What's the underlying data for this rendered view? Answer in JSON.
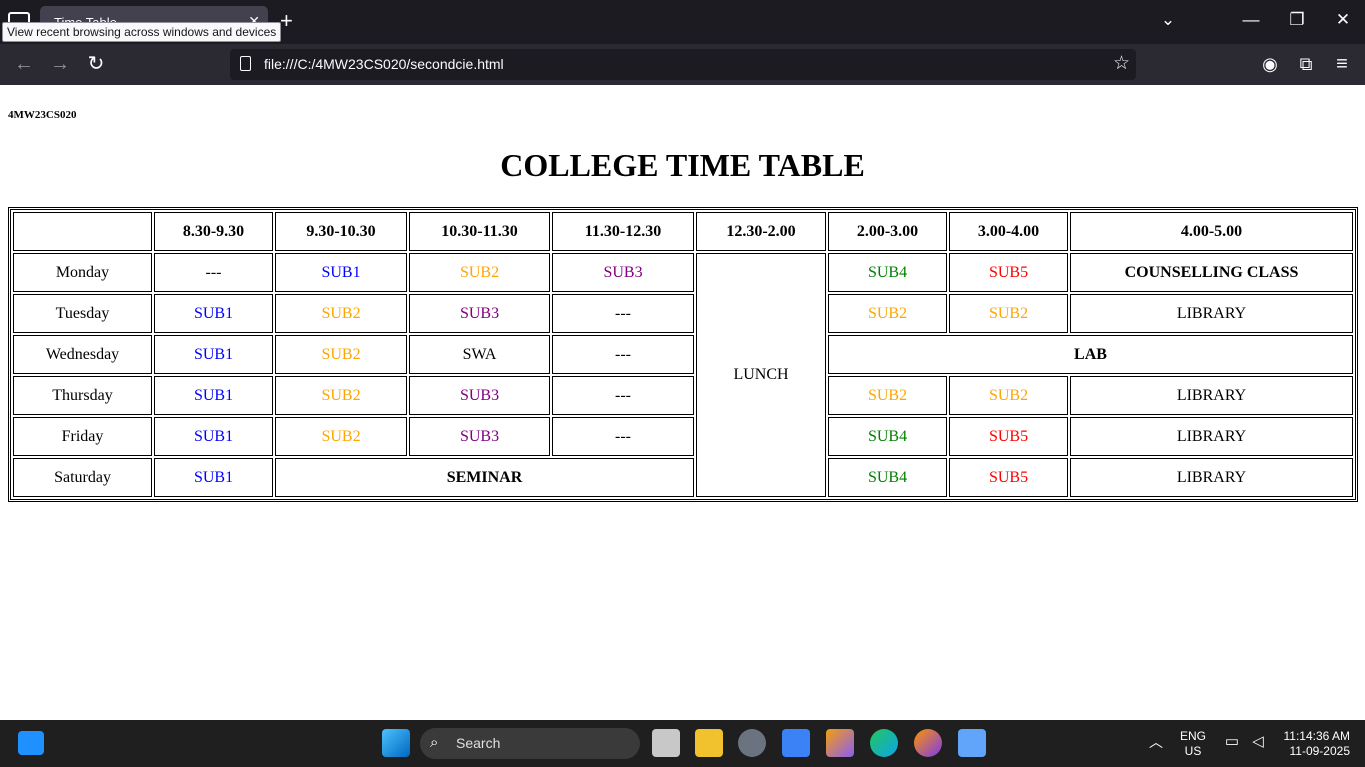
{
  "browser": {
    "tab_title": "Time Table",
    "tooltip": "View recent browsing across windows and devices",
    "url": "file:///C:/4MW23CS020/secondcie.html"
  },
  "page": {
    "roll_number": "4MW23CS020",
    "title": "COLLEGE TIME TABLE"
  },
  "colors": {
    "SUB1": "#0000ff",
    "SUB2": "#ffa500",
    "SUB3": "#800080",
    "SUB4": "#008000",
    "SUB5": "#ff0000"
  },
  "timetable": {
    "headers": [
      "",
      "8.30-9.30",
      "9.30-10.30",
      "10.30-11.30",
      "11.30-12.30",
      "12.30-2.00",
      "2.00-3.00",
      "3.00-4.00",
      "4.00-5.00"
    ],
    "days": [
      "Monday",
      "Tuesday",
      "Wednesday",
      "Thursday",
      "Friday",
      "Saturday"
    ],
    "lunch": "LUNCH",
    "lab": "LAB",
    "seminar": "SEMINAR",
    "counselling": "COUNSELLING CLASS",
    "library": "LIBRARY",
    "swa": "SWA",
    "free": "---",
    "rows": {
      "monday": [
        "---",
        "SUB1",
        "SUB2",
        "SUB3",
        "SUB4",
        "SUB5"
      ],
      "tuesday": [
        "SUB1",
        "SUB2",
        "SUB3",
        "---",
        "SUB2",
        "SUB2"
      ],
      "wednesday": [
        "SUB1",
        "SUB2",
        "SWA",
        "---"
      ],
      "thursday": [
        "SUB1",
        "SUB2",
        "SUB3",
        "---",
        "SUB2",
        "SUB2"
      ],
      "friday": [
        "SUB1",
        "SUB2",
        "SUB3",
        "---",
        "SUB4",
        "SUB5"
      ],
      "saturday": [
        "SUB1",
        "SUB4",
        "SUB5"
      ]
    }
  },
  "taskbar": {
    "search_placeholder": "Search",
    "lang_line1": "ENG",
    "lang_line2": "US",
    "time": "11:14:36 AM",
    "date": "11-09-2025"
  }
}
